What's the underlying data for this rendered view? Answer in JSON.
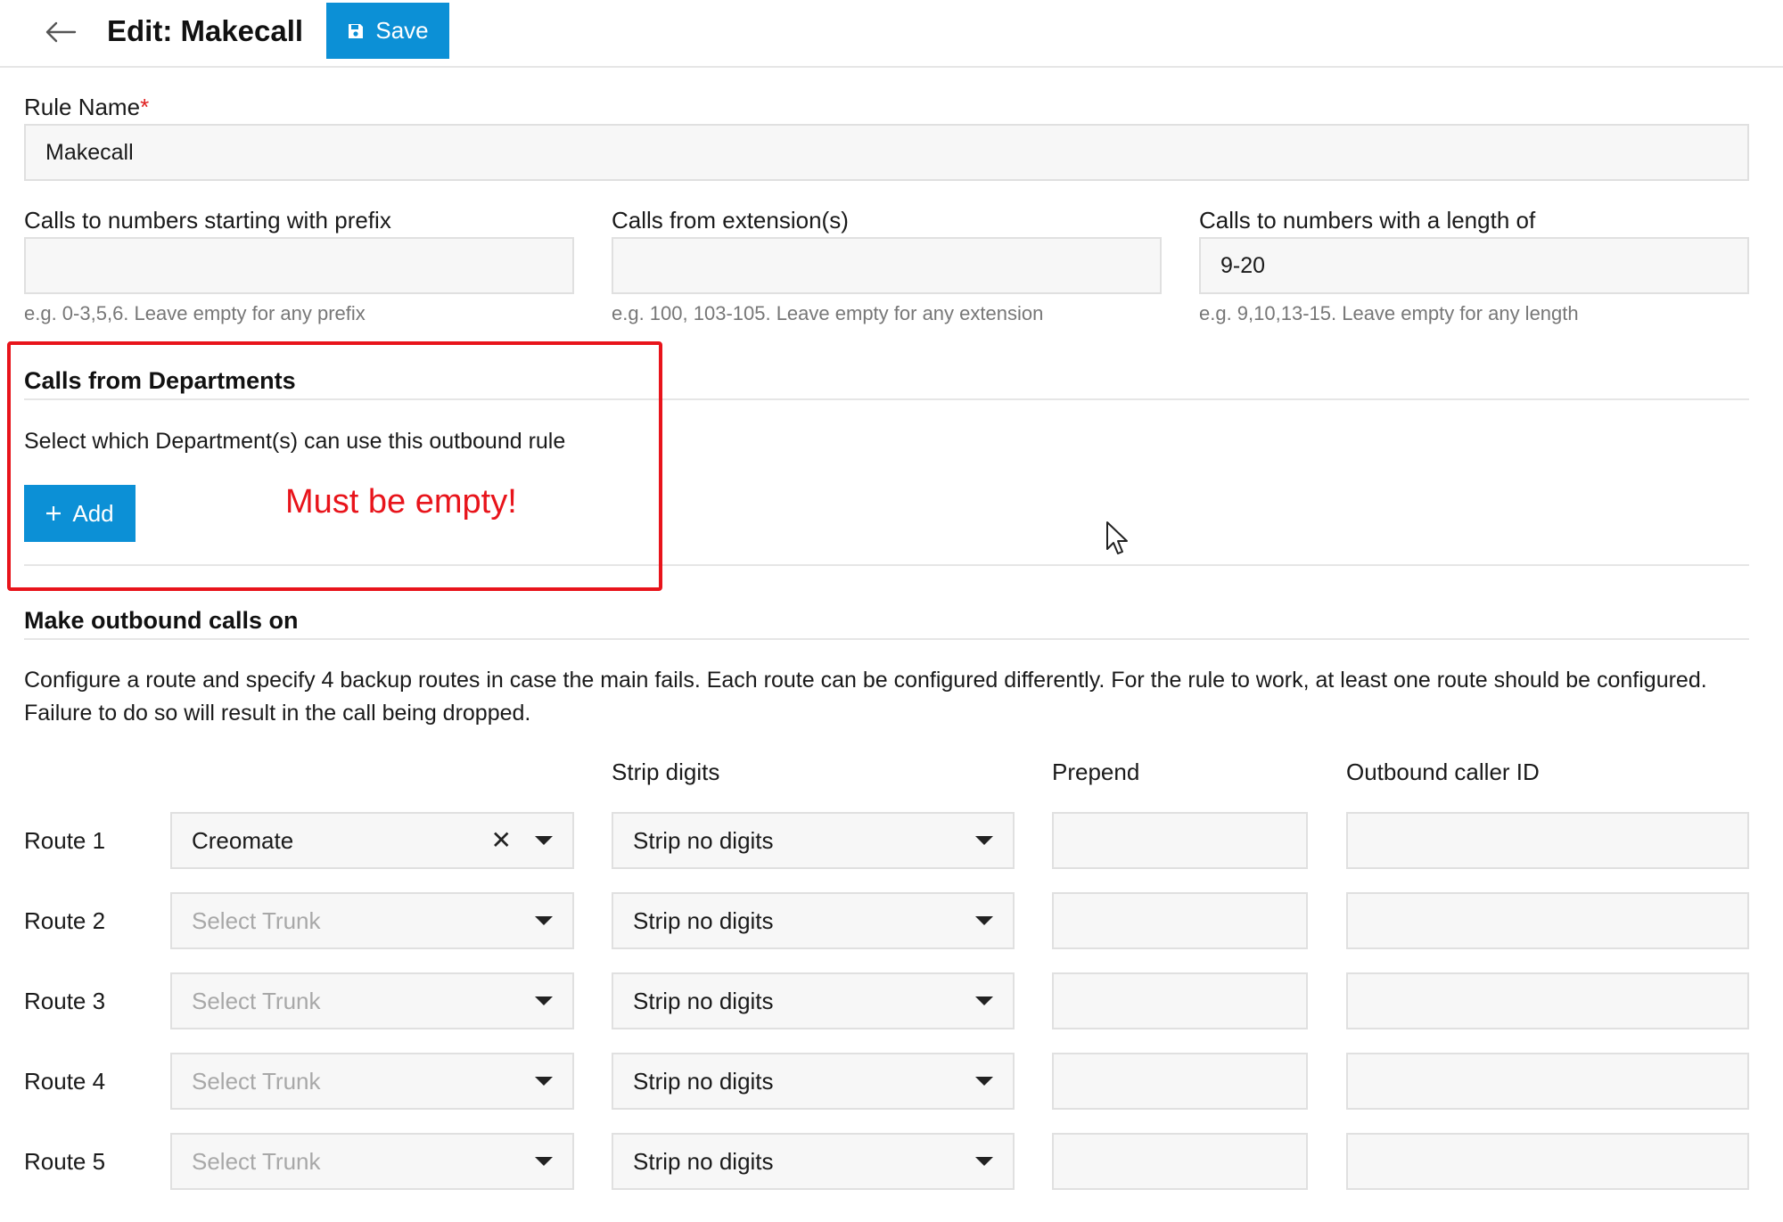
{
  "header": {
    "title": "Edit: Makecall",
    "save_label": "Save"
  },
  "rule_name": {
    "label": "Rule Name",
    "required_mark": "*",
    "value": "Makecall"
  },
  "prefix": {
    "label": "Calls to numbers starting with prefix",
    "value": "",
    "hint": "e.g. 0-3,5,6. Leave empty for any prefix"
  },
  "extensions": {
    "label": "Calls from extension(s)",
    "value": "",
    "hint": "e.g. 100, 103-105. Leave empty for any extension"
  },
  "length": {
    "label": "Calls to numbers with a length of",
    "value": "9-20",
    "hint": "e.g. 9,10,13-15. Leave empty for any length"
  },
  "departments": {
    "title": "Calls from Departments",
    "description": "Select which Department(s) can use this outbound rule",
    "add_label": "Add",
    "annotation": "Must be empty!"
  },
  "outbound": {
    "title": "Make outbound calls on",
    "description": "Configure a route and specify 4 backup routes in case the main fails. Each route can be configured differently. For the rule to work, at least one route should be configured. Failure to do so will result in the call being dropped.",
    "col_strip": "Strip digits",
    "col_prepend": "Prepend",
    "col_callerid": "Outbound caller ID"
  },
  "routes": [
    {
      "label": "Route 1",
      "trunk": "Creomate",
      "trunk_placeholder": "Select Trunk",
      "strip": "Strip no digits",
      "prepend": "",
      "caller_id": ""
    },
    {
      "label": "Route 2",
      "trunk": "",
      "trunk_placeholder": "Select Trunk",
      "strip": "Strip no digits",
      "prepend": "",
      "caller_id": ""
    },
    {
      "label": "Route 3",
      "trunk": "",
      "trunk_placeholder": "Select Trunk",
      "strip": "Strip no digits",
      "prepend": "",
      "caller_id": ""
    },
    {
      "label": "Route 4",
      "trunk": "",
      "trunk_placeholder": "Select Trunk",
      "strip": "Strip no digits",
      "prepend": "",
      "caller_id": ""
    },
    {
      "label": "Route 5",
      "trunk": "",
      "trunk_placeholder": "Select Trunk",
      "strip": "Strip no digits",
      "prepend": "",
      "caller_id": ""
    }
  ],
  "colors": {
    "accent": "#0c90d6",
    "annotation": "#e8141b",
    "input_bg": "#f7f7f7"
  }
}
